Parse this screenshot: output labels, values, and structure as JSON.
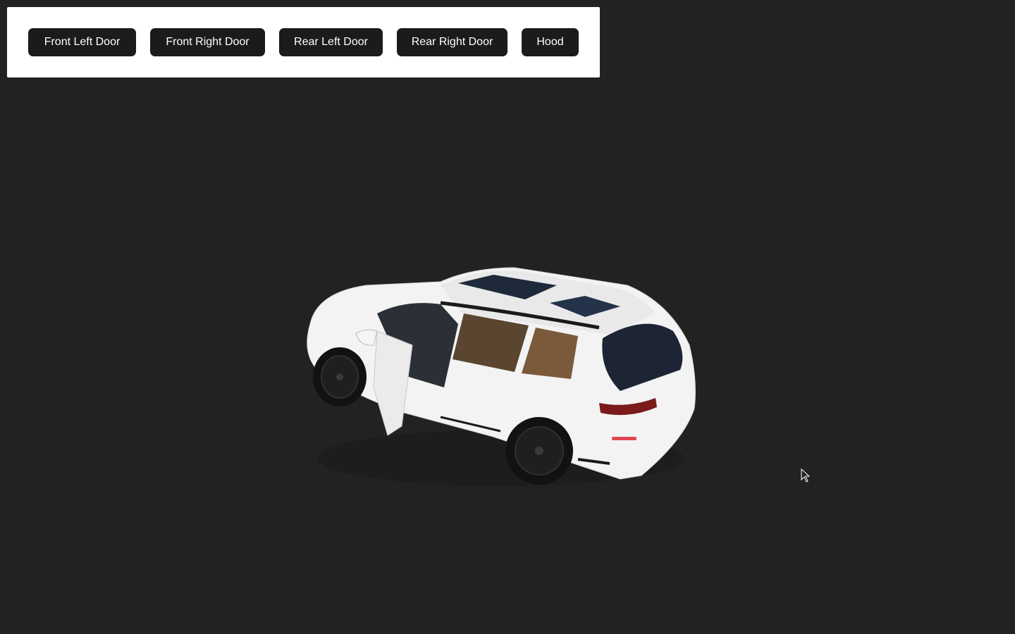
{
  "toolbar": {
    "buttons": [
      {
        "label": "Front Left Door"
      },
      {
        "label": "Front Right Door"
      },
      {
        "label": "Rear Left Door"
      },
      {
        "label": "Rear Right Door"
      },
      {
        "label": "Hood"
      }
    ]
  },
  "scene": {
    "background_color": "#222222",
    "model_color": "#f2f2f2",
    "model_icon": "suv-car-3d-model"
  },
  "cursor": {
    "icon": "mouse-pointer-icon"
  }
}
